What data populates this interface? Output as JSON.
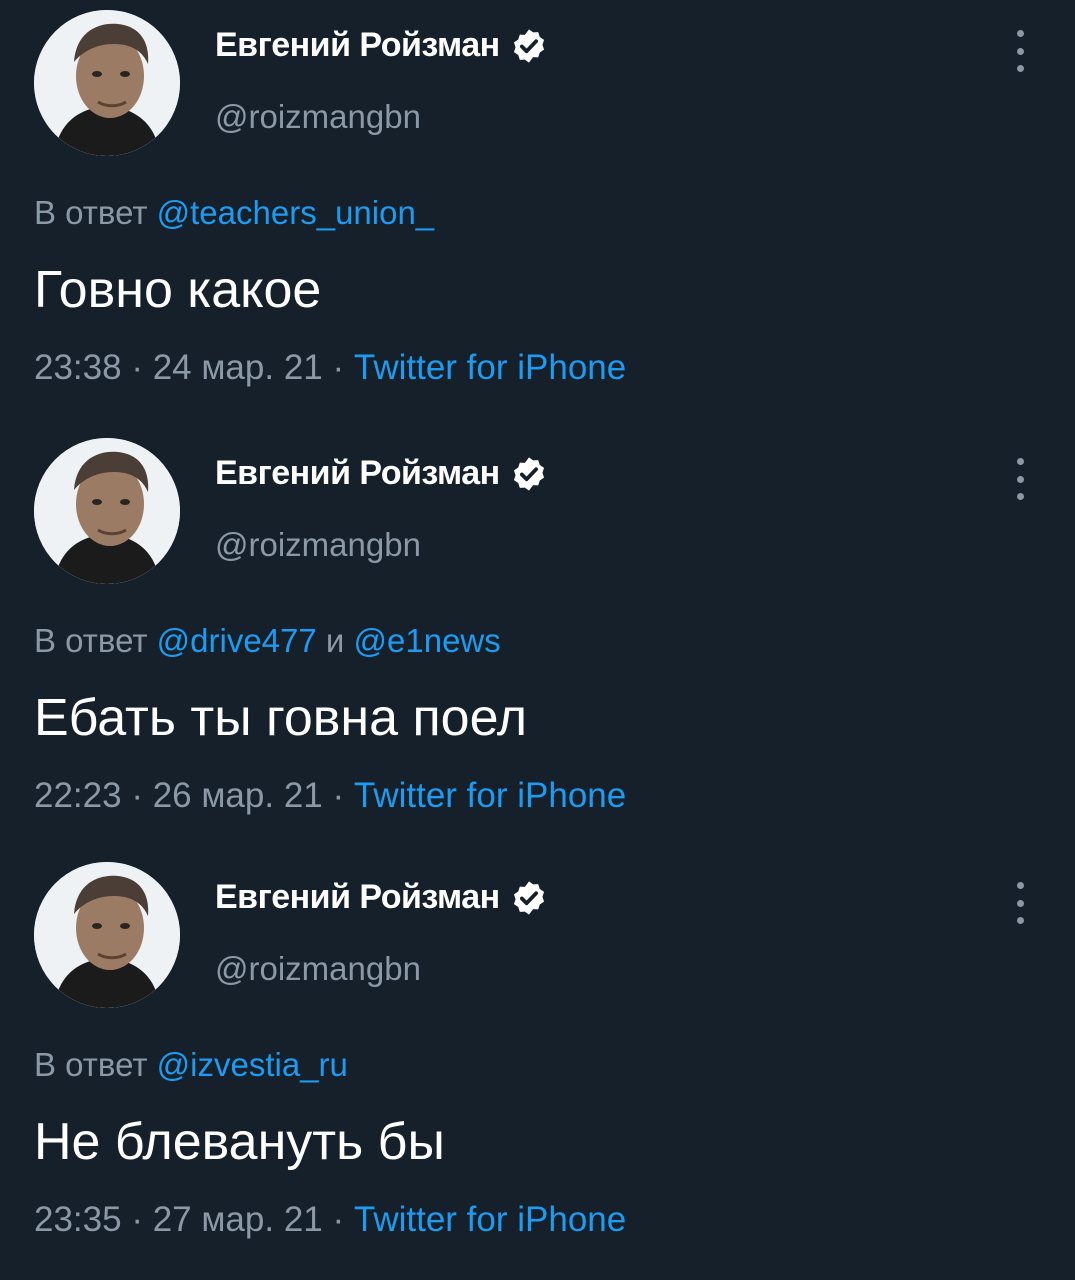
{
  "tweets": [
    {
      "author": {
        "name": "Евгений Ройзман",
        "handle": "@roizmangbn",
        "verified": true
      },
      "reply_prefix": "В ответ",
      "reply_to": [
        "@teachers_union_"
      ],
      "reply_joiner": "",
      "text": "Говно какое",
      "time": "23:38",
      "date": "24 мар. 21",
      "separator": "·",
      "source": "Twitter for iPhone"
    },
    {
      "author": {
        "name": "Евгений Ройзман",
        "handle": "@roizmangbn",
        "verified": true
      },
      "reply_prefix": "В ответ",
      "reply_to": [
        "@drive477",
        "@e1news"
      ],
      "reply_joiner": "и",
      "text": "Ебать ты говна поел",
      "time": "22:23",
      "date": "26 мар. 21",
      "separator": "·",
      "source": "Twitter for iPhone"
    },
    {
      "author": {
        "name": "Евгений Ройзман",
        "handle": "@roizmangbn",
        "verified": true
      },
      "reply_prefix": "В ответ",
      "reply_to": [
        "@izvestia_ru"
      ],
      "reply_joiner": "",
      "text": "Не блевануть бы",
      "time": "23:35",
      "date": "27 мар. 21",
      "separator": "·",
      "source": "Twitter for iPhone"
    }
  ],
  "icons": {
    "verified": "verified-badge-icon",
    "more": "more-vertical-icon"
  },
  "colors": {
    "background": "#15202b",
    "accent": "#1d9bf0",
    "secondary_text": "#8b98a5",
    "primary_text": "#ffffff"
  }
}
